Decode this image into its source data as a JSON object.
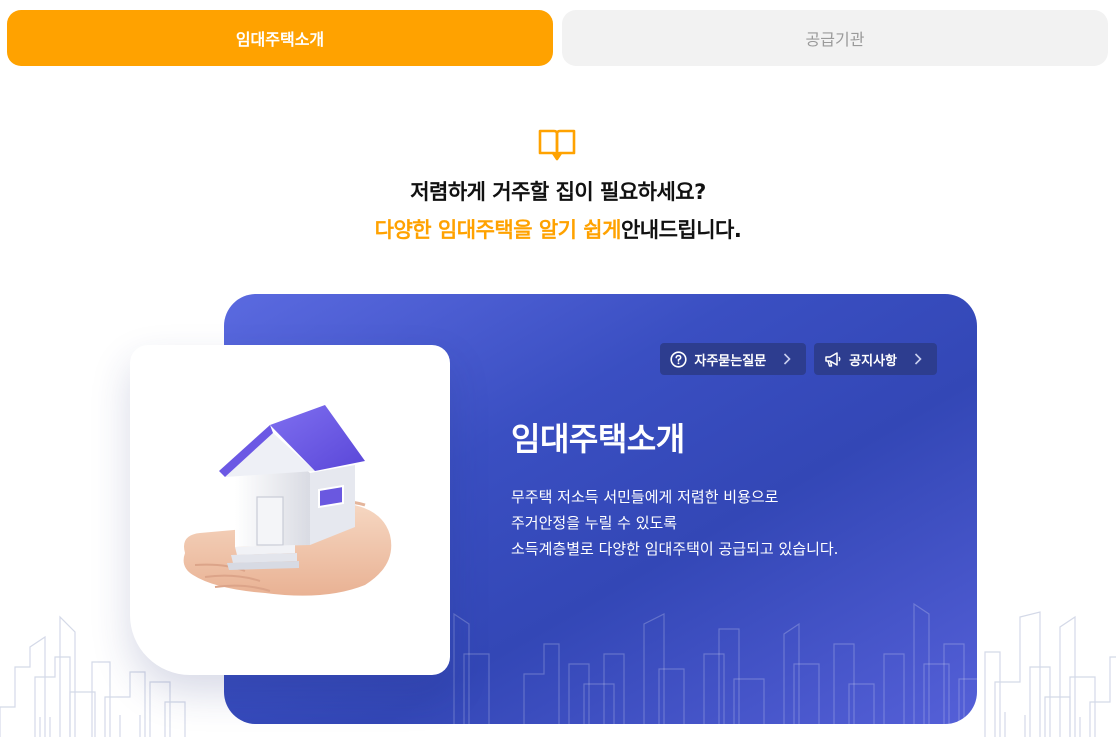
{
  "tabs": [
    {
      "label": "임대주택소개",
      "active": true
    },
    {
      "label": "공급기관",
      "active": false
    }
  ],
  "headline": {
    "line1": "저렴하게 거주할 집이 필요하세요?",
    "line2_highlight": "다양한 임대주택을 알기 쉽게",
    "line2_rest": "안내드립니다."
  },
  "card": {
    "buttons": [
      {
        "label": "자주묻는질문",
        "icon": "question-circle-icon"
      },
      {
        "label": "공지사항",
        "icon": "megaphone-icon"
      }
    ],
    "title": "임대주택소개",
    "description": [
      "무주택 저소득 서민들에게 저렴한 비용으로",
      "주거안정을 누릴 수 있도록",
      "소득계층별로 다양한 임대주택이 공급되고 있습니다."
    ]
  },
  "colors": {
    "accent": "#ffa200",
    "card_blue": "#3a4fc2",
    "pill_bg": "#2d3d8f",
    "inactive_tab_bg": "#f2f2f2"
  }
}
